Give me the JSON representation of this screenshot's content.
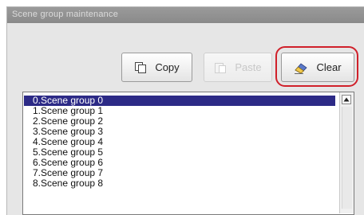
{
  "window": {
    "title": "Scene group maintenance"
  },
  "toolbar": {
    "copy_label": "Copy",
    "paste_label": "Paste",
    "clear_label": "Clear"
  },
  "list": {
    "items": [
      "0.Scene group 0",
      "1.Scene group 1",
      "2.Scene group 2",
      "3.Scene group 3",
      "4.Scene group 4",
      "5.Scene group 5",
      "6.Scene group 6",
      "7.Scene group 7",
      "8.Scene group 8"
    ],
    "selected_index": 0
  },
  "colors": {
    "selection": "#2c2a86",
    "highlight_ring": "#d0202a",
    "panel": "#e6e6e6"
  },
  "icons": [
    "copy-icon",
    "paste-icon",
    "eraser-icon",
    "scroll-up-arrow-icon"
  ]
}
